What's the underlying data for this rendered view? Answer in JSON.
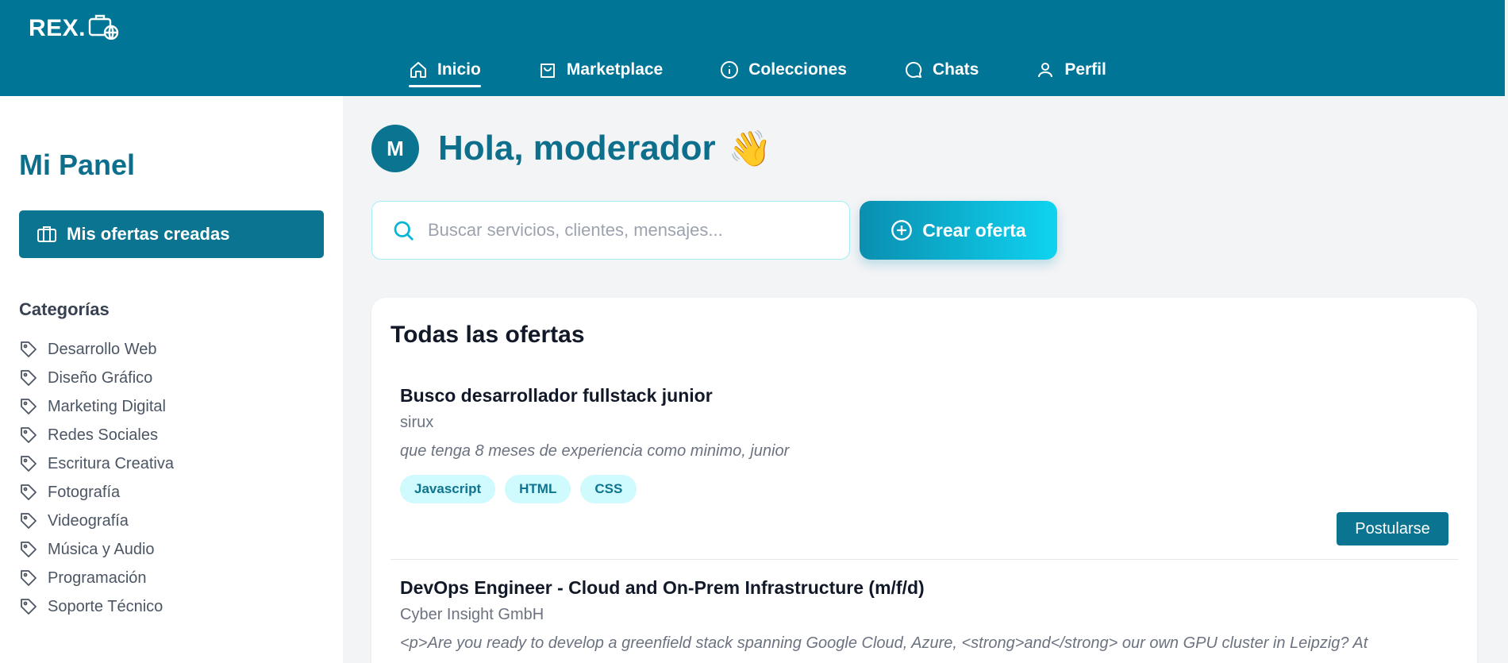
{
  "header": {
    "logo_text": "REX.",
    "nav": [
      {
        "label": "Inicio",
        "icon": "home-icon",
        "active": true
      },
      {
        "label": "Marketplace",
        "icon": "shopping-bag-icon"
      },
      {
        "label": "Colecciones",
        "icon": "info-icon"
      },
      {
        "label": "Chats",
        "icon": "chat-icon"
      },
      {
        "label": "Perfil",
        "icon": "user-icon"
      }
    ]
  },
  "sidebar": {
    "title": "Mi Panel",
    "my_offers_label": "Mis ofertas creadas",
    "categories_heading": "Categorías",
    "categories": [
      "Desarrollo Web",
      "Diseño Gráfico",
      "Marketing Digital",
      "Redes Sociales",
      "Escritura Creativa",
      "Fotografía",
      "Videografía",
      "Música y Audio",
      "Programación",
      "Soporte Técnico"
    ]
  },
  "main": {
    "avatar_initial": "M",
    "greeting": "Hola, moderador",
    "greeting_emoji": "👋",
    "search_placeholder": "Buscar servicios, clientes, mensajes...",
    "create_label": "Crear oferta",
    "offers_title": "Todas las ofertas",
    "offers": [
      {
        "title": "Busco desarrollador fullstack junior",
        "company": "sirux",
        "description": "que tenga 8 meses de experiencia como minimo, junior",
        "tags": [
          "Javascript",
          "HTML",
          "CSS"
        ],
        "apply_label": "Postularse"
      },
      {
        "title": "DevOps Engineer - Cloud and On-Prem Infrastructure (m/f/d)",
        "company": "Cyber Insight GmbH",
        "description": "<p>Are you ready to develop a greenfield stack spanning Google Cloud, Azure, <strong>and</strong> our own GPU cluster in Leipzig? At"
      }
    ]
  },
  "colors": {
    "primary": "#007596",
    "accent_gradient_start": "#0a8fb0",
    "accent_gradient_end": "#0fd3f0",
    "tag_bg": "#cffafe"
  }
}
